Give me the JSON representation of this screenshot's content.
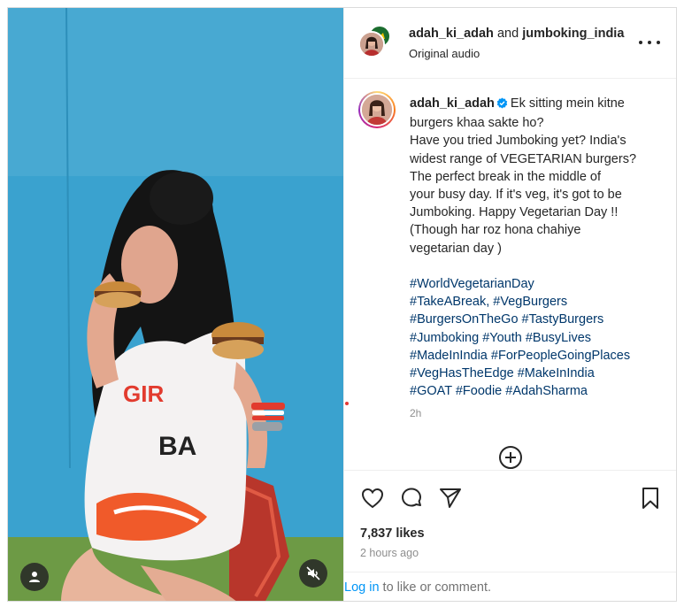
{
  "header": {
    "author": "adah_ki_adah",
    "joiner": "and",
    "collaborator": "jumboking_india",
    "audio": "Original audio"
  },
  "caption": {
    "username": "adah_ki_adah",
    "lines": [
      "Ek sitting mein kitne",
      "burgers khaa sakte ho?",
      "Have you tried Jumboking yet? India's",
      "widest range of VEGETARIAN burgers?",
      "The perfect break in the middle of",
      "your busy day. If it's veg, it's got to be",
      "Jumboking. Happy Vegetarian Day !!",
      "(Though har roz hona chahiye",
      "vegetarian day )"
    ],
    "hashtag_lines": [
      "#WorldVegetarianDay",
      "#TakeABreak, #VegBurgers",
      "#BurgersOnTheGo #TastyBurgers",
      "#Jumboking #Youth #BusyLives",
      "#MadeInIndia #ForPeopleGoingPlaces",
      "#VegHasTheEdge #MakeInIndia",
      "#GOAT #Foodie #AdahSharma"
    ],
    "time": "2h"
  },
  "stats": {
    "likes": "7,837 likes",
    "posted": "2 hours ago"
  },
  "login": {
    "link": "Log in",
    "rest": " to like or comment."
  },
  "icons": {
    "media_user": "user-tag-icon",
    "media_mute": "muted-speaker-icon",
    "more": "more-options-icon",
    "like": "heart-icon",
    "comment": "comment-icon",
    "share": "send-icon",
    "save": "bookmark-icon",
    "add": "plus-circle-icon",
    "verified": "verified-badge-icon"
  },
  "colors": {
    "link": "#0095f6",
    "hashtag": "#00376b",
    "verified": "#0095f6",
    "muted_text": "#8e8e8e"
  }
}
